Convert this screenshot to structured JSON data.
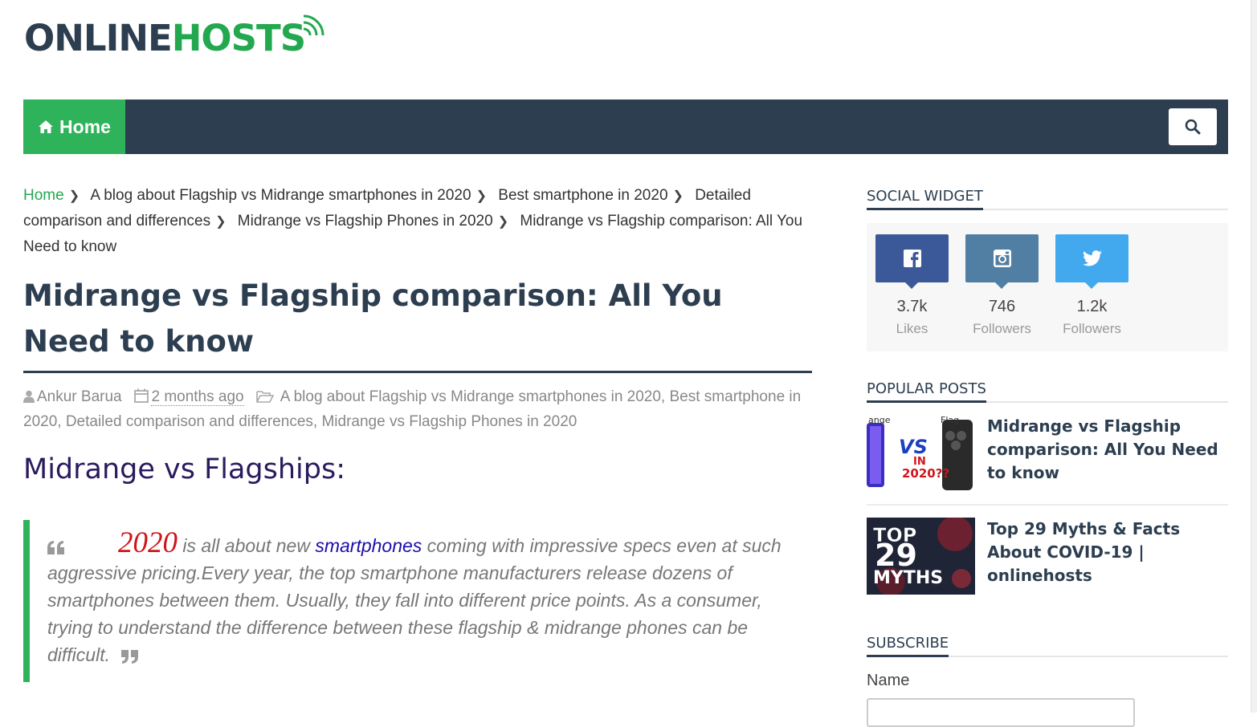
{
  "logo": {
    "part1": "ONLINE",
    "part2": "HOSTS"
  },
  "nav": {
    "home_label": "Home",
    "home_icon": "home-icon",
    "search_icon": "search-icon"
  },
  "breadcrumb": [
    "Home",
    "A blog about Flagship vs Midrange smartphones in 2020",
    "Best smartphone in 2020",
    "Detailed comparison and differences",
    "Midrange vs Flagship Phones in 2020",
    "Midrange vs Flagship comparison: All You Need to know"
  ],
  "post": {
    "title": "Midrange vs Flagship comparison: All You Need to know",
    "author": "Ankur Barua",
    "date": "2 months ago",
    "categories": [
      "A blog about Flagship vs Midrange smartphones in 2020,",
      "Best smartphone in 2020,",
      "Detailed comparison and differences,",
      "Midrange vs Flagship Phones in 2020"
    ],
    "section_heading": "Midrange vs Flagships:",
    "quote": {
      "year": "2020",
      "text1": " is all about new ",
      "keyword": "smartphones",
      "text2": " coming with impressive specs even at such aggressive pricing.Every year, the top smartphone manufacturers release dozens of smartphones between them. Usually, they fall into different price points. As a consumer, trying to understand the difference between these flagship & midrange  phones can be difficult."
    }
  },
  "sidebar": {
    "social_title": "SOCIAL WIDGET",
    "social": [
      {
        "icon": "facebook-icon",
        "count": "3.7k",
        "label": "Likes",
        "color": "#3b5998"
      },
      {
        "icon": "instagram-icon",
        "count": "746",
        "label": "Followers",
        "color": "#517fa4"
      },
      {
        "icon": "twitter-icon",
        "count": "1.2k",
        "label": "Followers",
        "color": "#43a9ef"
      }
    ],
    "popular_title": "POPULAR POSTS",
    "popular": [
      {
        "title": "Midrange vs Flagship comparison: All You Need to know",
        "thumb_top": "ange",
        "thumb_top2": "Flag",
        "thumb_vs": "VS",
        "thumb_in": "IN",
        "thumb_year": "2020??"
      },
      {
        "title": "Top 29 Myths & Facts About COVID-19 | onlinehosts",
        "thumb_line1": "TOP",
        "thumb_line2": "29",
        "thumb_line3": "MYTHS"
      }
    ],
    "subscribe_title": "SUBSCRIBE",
    "name_label": "Name"
  },
  "colors": {
    "nav_bg": "#2c3e50",
    "accent_green": "#2eb35b",
    "heading": "#2c3e50",
    "highlight_red": "#d0151b",
    "link_blue": "#1a0dab"
  }
}
